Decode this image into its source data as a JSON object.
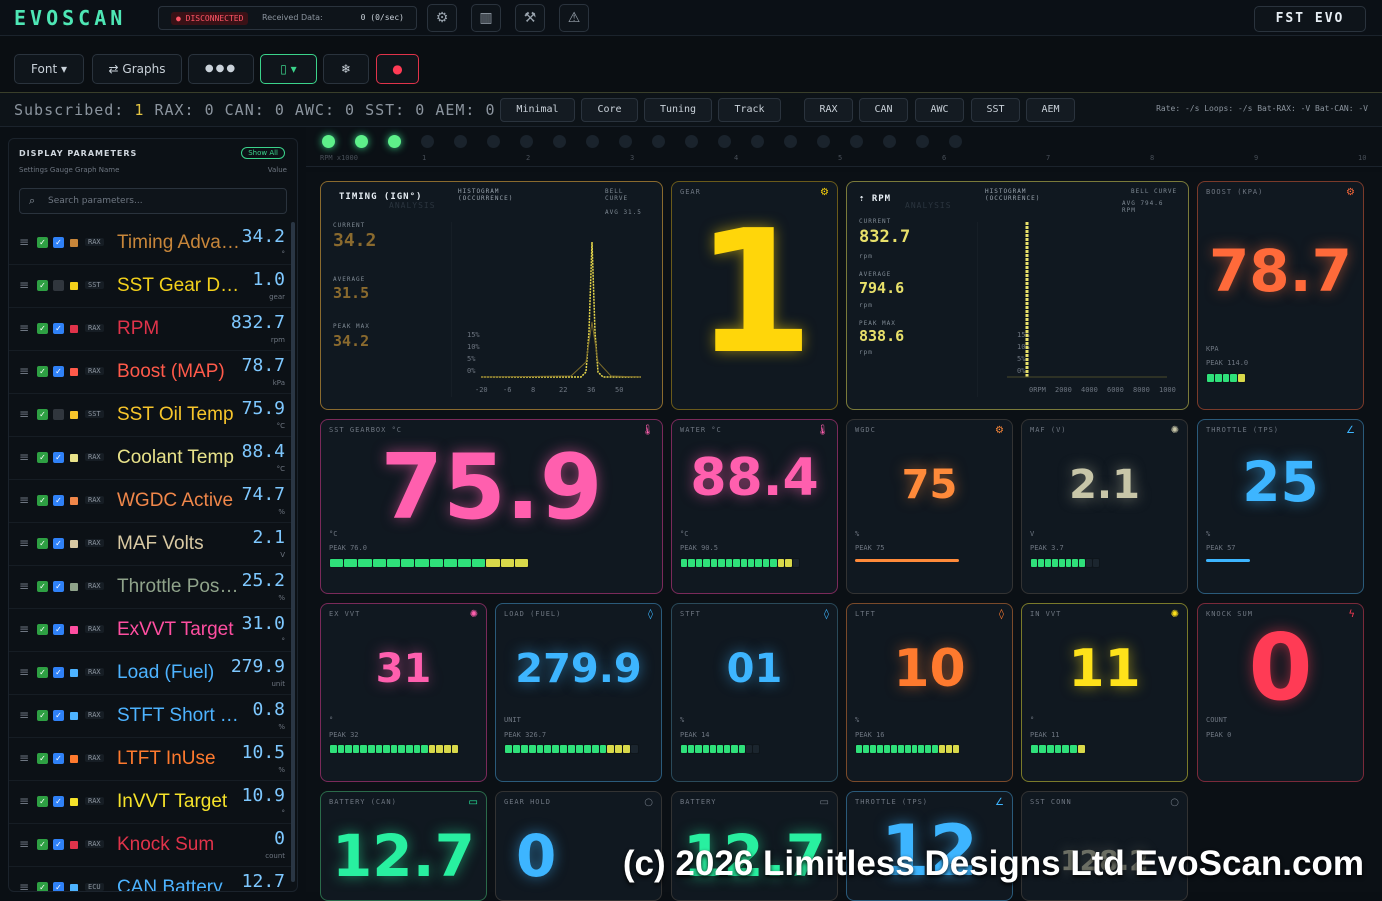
{
  "app": {
    "logo": "EVOSCAN",
    "vehicle": "FST EVO"
  },
  "status": {
    "connection": "DISCONNECTED",
    "received_label": "Received Data:",
    "received_value": "0 (0/sec)"
  },
  "toolbar": {
    "font_label": "Font ▾",
    "graphs_label": "Graphs",
    "more_label": "●●●"
  },
  "subscribed": {
    "prefix": "Subscribed:",
    "total": "1",
    "rax_label": "RAX:",
    "rax": "0",
    "can_label": "CAN:",
    "can": "0",
    "awc_label": "AWC:",
    "awc": "0",
    "sst_label": "SST:",
    "sst": "0",
    "aem_label": "AEM:",
    "aem": "0"
  },
  "presets": [
    "Minimal",
    "Core",
    "Tuning",
    "Track"
  ],
  "sources": [
    "RAX",
    "CAN",
    "AWC",
    "SST",
    "AEM"
  ],
  "rates": "Rate: -/s  Loops: -/s  Bat-RAX: -V  Bat-CAN: -V",
  "sidebar": {
    "title": "DISPLAY PARAMETERS",
    "show_all": "Show All",
    "subheader": "Settings  Gauge  Graph  Name",
    "value_header": "Value",
    "search_placeholder": "Search parameters...",
    "items": [
      {
        "name": "Timing Advance",
        "src": "RAX",
        "value": "34.2",
        "unit": "°",
        "color": "#c8863a",
        "graph": true
      },
      {
        "name": "SST Gear Display",
        "src": "SST",
        "value": "1.0",
        "unit": "gear",
        "color": "#f3d11b",
        "graph": false
      },
      {
        "name": "RPM",
        "src": "RAX",
        "value": "832.7",
        "unit": "rpm",
        "color": "#e0334a",
        "graph": true
      },
      {
        "name": "Boost (MAP)",
        "src": "RAX",
        "value": "78.7",
        "unit": "kPa",
        "color": "#ff5a4a",
        "graph": true
      },
      {
        "name": "SST Oil Temp",
        "src": "SST",
        "value": "75.9",
        "unit": "°C",
        "color": "#f7c52b",
        "graph": false
      },
      {
        "name": "Coolant Temp",
        "src": "RAX",
        "value": "88.4",
        "unit": "°C",
        "color": "#e9e38a",
        "graph": true
      },
      {
        "name": "WGDC Active",
        "src": "RAX",
        "value": "74.7",
        "unit": "%",
        "color": "#f0874a",
        "graph": true
      },
      {
        "name": "MAF Volts",
        "src": "RAX",
        "value": "2.1",
        "unit": "V",
        "color": "#d8c9a3",
        "graph": true
      },
      {
        "name": "Throttle Position",
        "src": "RAX",
        "value": "25.2",
        "unit": "%",
        "color": "#8fa38a",
        "graph": true
      },
      {
        "name": "ExVVT Target",
        "src": "RAX",
        "value": "31.0",
        "unit": "°",
        "color": "#ff4fa1",
        "graph": true
      },
      {
        "name": "Load (Fuel)",
        "src": "RAX",
        "value": "279.9",
        "unit": "unit",
        "color": "#4db3ff",
        "graph": true
      },
      {
        "name": "STFT Short Term",
        "src": "RAX",
        "value": "0.8",
        "unit": "%",
        "color": "#4db3ff",
        "graph": true
      },
      {
        "name": "LTFT InUse",
        "src": "RAX",
        "value": "10.5",
        "unit": "%",
        "color": "#ff7a2e",
        "graph": true
      },
      {
        "name": "InVVT Target",
        "src": "RAX",
        "value": "10.9",
        "unit": "°",
        "color": "#f5e22a",
        "graph": true
      },
      {
        "name": "Knock Sum",
        "src": "RAX",
        "value": "0",
        "unit": "count",
        "color": "#e0334a",
        "graph": true
      },
      {
        "name": "CAN Battery",
        "src": "ECU",
        "value": "12.7",
        "unit": "V",
        "color": "#4db3ff",
        "graph": true
      }
    ]
  },
  "lights": {
    "label": "RPM x1000",
    "ticks": [
      "1",
      "2",
      "3",
      "4",
      "5",
      "6",
      "7",
      "8",
      "9",
      "10"
    ],
    "on_count": 3
  },
  "cards": {
    "timing": {
      "title": "TIMING (IGN°)",
      "analysis": "ANALYSIS",
      "hist": "HISTOGRAM (OCCURRENCE)",
      "bell": "BELL CURVE",
      "avg": "AVG 31.5",
      "current_l": "CURRENT",
      "current": "34.2",
      "average_l": "AVERAGE",
      "average": "31.5",
      "peak_l": "PEAK MAX",
      "peak": "34.2",
      "xticks": [
        "-20",
        "-6",
        "8",
        "22",
        "36",
        "50"
      ],
      "yticks": [
        "15%",
        "10%",
        "5%",
        "0%"
      ],
      "color": "#b9913c"
    },
    "gear": {
      "title": "GEAR",
      "value": "1",
      "color": "#ffd60a"
    },
    "rpm": {
      "title": "RPM",
      "analysis": "ANALYSIS",
      "hist": "HISTOGRAM (OCCURRENCE)",
      "bell": "BELL CURVE",
      "avg": "AVG 794.6 RPM",
      "current_l": "CURRENT",
      "current": "832.7",
      "average_l": "AVERAGE",
      "average": "794.6",
      "peak_l": "PEAK MAX",
      "peak": "838.6",
      "unit": "rpm",
      "xticks": [
        "0RPM",
        "2000",
        "4000",
        "6000",
        "8000",
        "1000"
      ],
      "yticks": [
        "15%",
        "10%",
        "5%",
        "0%"
      ],
      "color": "#e8e06a"
    },
    "boost": {
      "title": "BOOST (KPA)",
      "value": "78.7",
      "unit": "KPA",
      "peak": "PEAK 114.0",
      "color": "#ff6a3a"
    },
    "sst": {
      "title": "SST GEARBOX °C",
      "value": "75.9",
      "unit": "°C",
      "peak": "PEAK 76.0",
      "color": "#ff5fae"
    },
    "water": {
      "title": "WATER °C",
      "value": "88.4",
      "unit": "°C",
      "peak": "PEAK 90.5",
      "color": "#ff5fae"
    },
    "wgdc": {
      "title": "WGDC",
      "value": "75",
      "unit": "%",
      "peak": "PEAK 75",
      "color": "#ff8a3a"
    },
    "maf": {
      "title": "MAF (V)",
      "value": "2.1",
      "unit": "V",
      "peak": "PEAK 3.7",
      "color": "#c8c6a8"
    },
    "throttle": {
      "title": "THROTTLE (TPS)",
      "value": "25",
      "unit": "%",
      "peak": "PEAK 57",
      "color": "#3db5ff"
    },
    "exvvt": {
      "title": "EX VVT",
      "value": "31",
      "unit": "°",
      "peak": "PEAK 32",
      "color": "#ff5fae"
    },
    "load": {
      "title": "LOAD (FUEL)",
      "value": "279.9",
      "unit": "UNIT",
      "peak": "PEAK 326.7",
      "color": "#3db5ff"
    },
    "stft": {
      "title": "STFT",
      "value": "01",
      "unit": "%",
      "peak": "PEAK 14",
      "color": "#3db5ff"
    },
    "ltft": {
      "title": "LTFT",
      "value": "10",
      "unit": "%",
      "peak": "PEAK 16",
      "color": "#ff7a2e"
    },
    "invvt": {
      "title": "IN VVT",
      "value": "11",
      "unit": "°",
      "peak": "PEAK 11",
      "color": "#ffe21a"
    },
    "knock": {
      "title": "KNOCK SUM",
      "value": "0",
      "unit": "COUNT",
      "peak": "PEAK 0",
      "color": "#ff3b55"
    },
    "battery_can": {
      "title": "BATTERY (CAN)",
      "value": "12.7",
      "color": "#28f0a0"
    },
    "gear_hold": {
      "title": "GEAR HOLD",
      "value": "0",
      "color": "#3db5ff"
    },
    "battery": {
      "title": "BATTERY",
      "value": "12.7",
      "color": "#28f0a0"
    },
    "throttle2": {
      "title": "THROTTLE (TPS)",
      "value": "12",
      "color": "#3db5ff"
    },
    "sst_conn": {
      "title": "SST CONN",
      "value": "128.2",
      "color": "#c8c6a8"
    }
  },
  "watermark": "(c) 2026 Limitless Designs Ltd EvoScan.com"
}
